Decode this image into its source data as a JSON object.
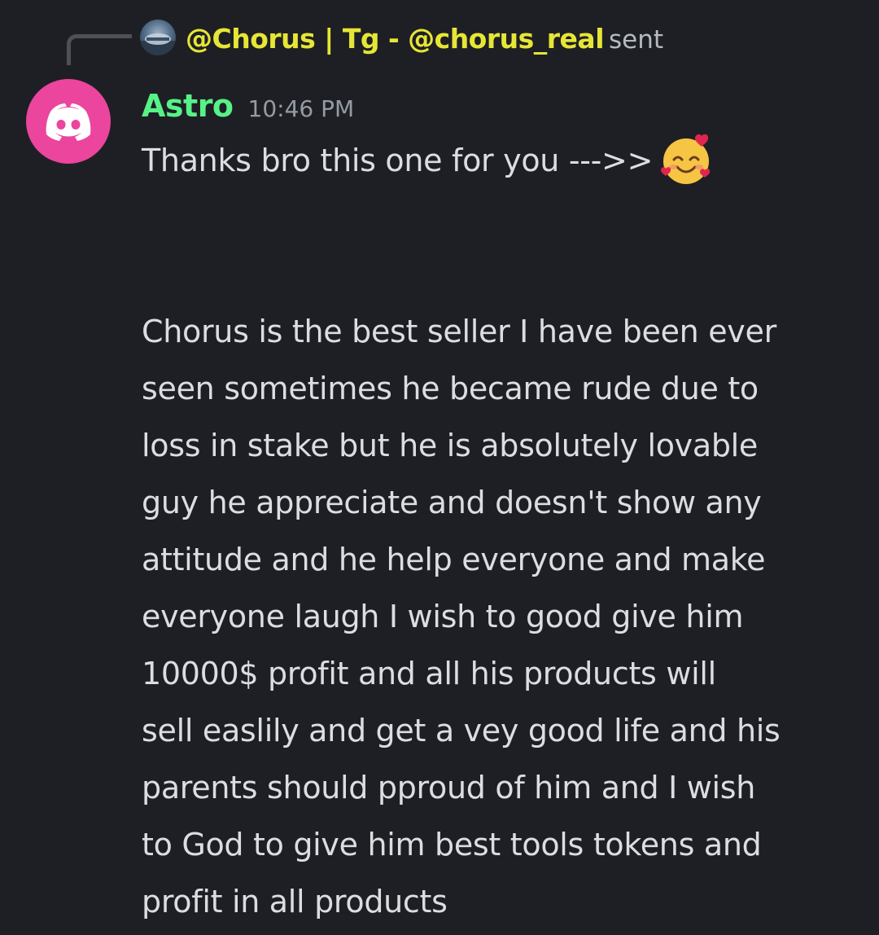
{
  "reply": {
    "author": "@Chorus | Tg - @chorus_real",
    "action": "sent"
  },
  "message": {
    "author": "Astro",
    "timestamp": "10:46 PM",
    "first_line": "Thanks bro this one for you --->>",
    "first_line_emoji": "smiling-face-with-hearts-icon",
    "body": "Chorus is the best seller I have been ever\nseen sometimes he became rude due to\nloss in stake but he is absolutely lovable\nguy he appreciate and doesn't show any\nattitude and he help everyone and make\neveryone laugh I wish to good give him\n10000$ profit and all his products will\nsell easlily and get a vey good life and his\nparents should pproud of him and  I wish\nto God to give him best tools tokens and\nprofit in all products"
  },
  "colors": {
    "background": "#1e1f24",
    "username": "#57f287",
    "reply_author": "#e6e636",
    "avatar": "#eb459e",
    "text": "#dbdee1",
    "muted": "#949ba4"
  }
}
